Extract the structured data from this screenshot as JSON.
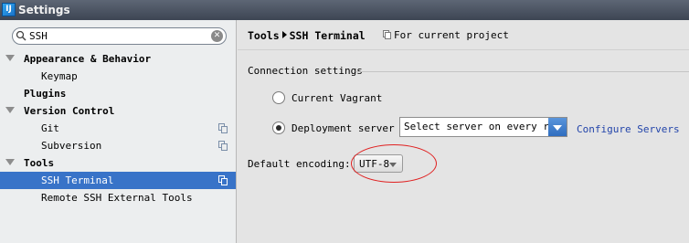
{
  "window": {
    "title": "Settings",
    "app_icon_text": "IJ"
  },
  "search": {
    "value": "SSH"
  },
  "tree": [
    {
      "label": "Appearance & Behavior",
      "level": 0,
      "expandable": true
    },
    {
      "label": "Keymap",
      "level": 1
    },
    {
      "label": "Plugins",
      "level": 0
    },
    {
      "label": "Version Control",
      "level": 0,
      "expandable": true
    },
    {
      "label": "Git",
      "level": 1,
      "project_icon": true
    },
    {
      "label": "Subversion",
      "level": 1,
      "project_icon": true
    },
    {
      "label": "Tools",
      "level": 0,
      "expandable": true
    },
    {
      "label": "SSH Terminal",
      "level": 1,
      "project_icon": true,
      "selected": true
    },
    {
      "label": "Remote SSH External Tools",
      "level": 1
    }
  ],
  "breadcrumb": {
    "parent": "Tools",
    "current": "SSH Terminal"
  },
  "scope": {
    "label": "For current project"
  },
  "connection": {
    "group_title": "Connection settings",
    "option_vagrant": "Current Vagrant",
    "option_deployment": "Deployment server",
    "selected_option": "deployment",
    "server_select_value": "Select server on every run",
    "configure_link": "Configure Servers"
  },
  "encoding": {
    "label": "Default encoding:",
    "value": "UTF-8"
  },
  "colors": {
    "selection": "#3873c8",
    "annotation": "#e02020",
    "link": "#2244aa"
  }
}
